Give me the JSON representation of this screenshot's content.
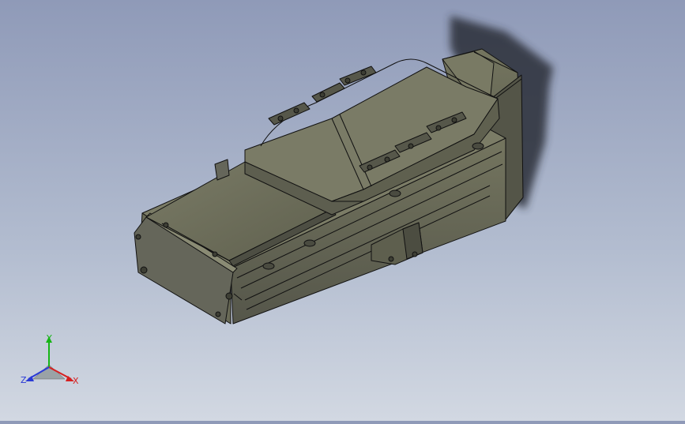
{
  "viewport": {
    "background_top": "#8f9ab8",
    "background_bottom": "#d2d8e2"
  },
  "model": {
    "body_color": "#6f705c",
    "edge_color": "#111111"
  },
  "triad": {
    "x_label": "X",
    "y_label": "Y",
    "z_label": "Z",
    "x_color": "#d62020",
    "y_color": "#16b516",
    "z_color": "#2a3ad6"
  }
}
